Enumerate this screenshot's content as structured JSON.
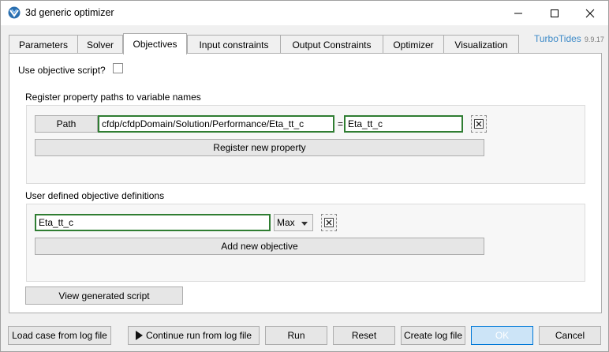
{
  "window": {
    "title": "3d generic optimizer"
  },
  "tabs": [
    {
      "label": "Parameters"
    },
    {
      "label": "Solver"
    },
    {
      "label": "Objectives"
    },
    {
      "label": "Input constraints"
    },
    {
      "label": "Output Constraints"
    },
    {
      "label": "Optimizer"
    },
    {
      "label": "Visualization"
    }
  ],
  "brand": {
    "name": "TurboTides",
    "version": "9.9.17"
  },
  "objectives": {
    "use_script_label": "Use objective script?",
    "register_section_label": "Register property paths to variable names",
    "path_button": "Path",
    "path_value": "cfdp/cfdpDomain/Solution/Performance/Eta_tt_c",
    "equals": "=",
    "var_name": "Eta_tt_c",
    "register_button": "Register new property",
    "user_defined_label": "User defined objective definitions",
    "objective_expr": "Eta_tt_c",
    "objective_sense": "Max",
    "add_objective_button": "Add new objective",
    "view_script_button": "View generated script"
  },
  "footer": {
    "load_case": "Load case from log file",
    "continue_run": "Continue run from log file",
    "run": "Run",
    "reset": "Reset",
    "create_log": "Create log file",
    "ok": "OK",
    "cancel": "Cancel"
  }
}
